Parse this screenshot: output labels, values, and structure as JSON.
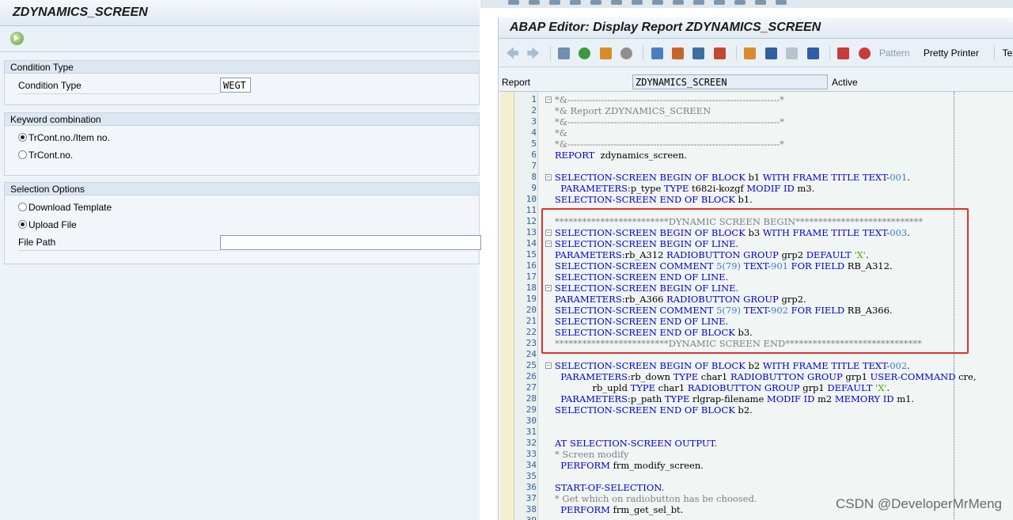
{
  "left": {
    "title": "ZDYNAMICS_SCREEN",
    "groups": {
      "condition": {
        "header": "Condition Type",
        "label": "Condition Type",
        "value": "WEGT"
      },
      "keyword": {
        "header": "Keyword combination",
        "options": [
          "TrCont.no./Item no.",
          "TrCont.no."
        ],
        "selected": 0
      },
      "selection": {
        "header": "Selection Options",
        "options": [
          "Download Template",
          "Upload File"
        ],
        "selected": 1,
        "file_label": "File Path",
        "file_value": ""
      }
    }
  },
  "right": {
    "title": "ABAP Editor: Display Report ZDYNAMICS_SCREEN",
    "toolbar": {
      "pattern": "Pattern",
      "pretty": "Pretty Printer",
      "text_elem": "Text Eler"
    },
    "report_label": "Report",
    "report_value": "ZDYNAMICS_SCREEN",
    "status": "Active"
  },
  "code_lines": [
    {
      "n": "1",
      "parts": [
        [
          "cm",
          "*&---------------------------------------------------------------------*"
        ]
      ]
    },
    {
      "n": "2",
      "parts": [
        [
          "cm",
          "*& Report ZDYNAMICS_SCREEN"
        ]
      ]
    },
    {
      "n": "3",
      "parts": [
        [
          "cm",
          "*&---------------------------------------------------------------------*"
        ]
      ]
    },
    {
      "n": "4",
      "parts": [
        [
          "cm",
          "*&"
        ]
      ]
    },
    {
      "n": "5",
      "parts": [
        [
          "cm",
          "*&---------------------------------------------------------------------*"
        ]
      ]
    },
    {
      "n": "6",
      "parts": [
        [
          "kw",
          "REPORT"
        ],
        [
          "",
          "  zdynamics_screen."
        ]
      ]
    },
    {
      "n": "7",
      "parts": []
    },
    {
      "n": "8",
      "parts": [
        [
          "kw",
          "SELECTION-SCREEN BEGIN OF BLOCK"
        ],
        [
          "",
          " b1 "
        ],
        [
          "kw",
          "WITH FRAME TITLE TEXT-"
        ],
        [
          "num",
          "001"
        ],
        [
          "",
          "."
        ]
      ]
    },
    {
      "n": "9",
      "parts": [
        [
          "kw",
          "  PARAMETERS"
        ],
        [
          "",
          ":p_type "
        ],
        [
          "kw",
          "TYPE"
        ],
        [
          "",
          " t682i-kozgf "
        ],
        [
          "kw",
          "MODIF ID"
        ],
        [
          "",
          " m3."
        ]
      ]
    },
    {
      "n": "10",
      "parts": [
        [
          "kw",
          "SELECTION-SCREEN END OF BLOCK"
        ],
        [
          "",
          " b1."
        ]
      ]
    },
    {
      "n": "11",
      "parts": []
    },
    {
      "n": "12",
      "parts": [
        [
          "cm",
          "*************************DYNAMIC SCREEN BEGIN****************************"
        ]
      ]
    },
    {
      "n": "13",
      "parts": [
        [
          "kw",
          "SELECTION-SCREEN BEGIN OF BLOCK"
        ],
        [
          "",
          " b3 "
        ],
        [
          "kw",
          "WITH FRAME TITLE TEXT-"
        ],
        [
          "num",
          "003"
        ],
        [
          "",
          "."
        ]
      ]
    },
    {
      "n": "14",
      "parts": [
        [
          "kw",
          "SELECTION-SCREEN BEGIN OF LINE."
        ]
      ]
    },
    {
      "n": "15",
      "parts": [
        [
          "kw",
          "PARAMETERS"
        ],
        [
          "",
          ":rb_A312 "
        ],
        [
          "kw",
          "RADIOBUTTON GROUP"
        ],
        [
          "",
          " grp2 "
        ],
        [
          "kw",
          "DEFAULT"
        ],
        [
          "",
          " "
        ],
        [
          "str",
          "'X'"
        ],
        [
          "",
          "."
        ]
      ]
    },
    {
      "n": "16",
      "parts": [
        [
          "kw",
          "SELECTION-SCREEN COMMENT"
        ],
        [
          "",
          " "
        ],
        [
          "num",
          "5(79)"
        ],
        [
          "",
          " "
        ],
        [
          "kw",
          "TEXT-"
        ],
        [
          "num",
          "901"
        ],
        [
          "",
          " "
        ],
        [
          "kw",
          "FOR FIELD"
        ],
        [
          "",
          " RB_A312."
        ]
      ]
    },
    {
      "n": "17",
      "parts": [
        [
          "kw",
          "SELECTION-SCREEN END OF LINE."
        ]
      ]
    },
    {
      "n": "18",
      "parts": [
        [
          "kw",
          "SELECTION-SCREEN BEGIN OF LINE."
        ]
      ]
    },
    {
      "n": "19",
      "parts": [
        [
          "kw",
          "PARAMETERS"
        ],
        [
          "",
          ":rb_A366 "
        ],
        [
          "kw",
          "RADIOBUTTON GROUP"
        ],
        [
          "",
          " grp2."
        ]
      ]
    },
    {
      "n": "20",
      "parts": [
        [
          "kw",
          "SELECTION-SCREEN COMMENT"
        ],
        [
          "",
          " "
        ],
        [
          "num",
          "5(79)"
        ],
        [
          "",
          " "
        ],
        [
          "kw",
          "TEXT-"
        ],
        [
          "num",
          "902"
        ],
        [
          "",
          " "
        ],
        [
          "kw",
          "FOR FIELD"
        ],
        [
          "",
          " RB_A366."
        ]
      ]
    },
    {
      "n": "21",
      "parts": [
        [
          "kw",
          "SELECTION-SCREEN END OF LINE."
        ]
      ]
    },
    {
      "n": "22",
      "parts": [
        [
          "kw",
          "SELECTION-SCREEN END OF BLOCK"
        ],
        [
          "",
          " b3."
        ]
      ]
    },
    {
      "n": "23",
      "parts": [
        [
          "cm",
          "*************************DYNAMIC SCREEN END******************************"
        ]
      ]
    },
    {
      "n": "24",
      "parts": []
    },
    {
      "n": "25",
      "parts": [
        [
          "kw",
          "SELECTION-SCREEN BEGIN OF BLOCK"
        ],
        [
          "",
          " b2 "
        ],
        [
          "kw",
          "WITH FRAME TITLE TEXT-"
        ],
        [
          "num",
          "002"
        ],
        [
          "",
          "."
        ]
      ]
    },
    {
      "n": "26",
      "parts": [
        [
          "kw",
          "  PARAMETERS"
        ],
        [
          "",
          ":rb_down "
        ],
        [
          "kw",
          "TYPE"
        ],
        [
          "",
          " char1 "
        ],
        [
          "kw",
          "RADIOBUTTON GROUP"
        ],
        [
          "",
          " grp1 "
        ],
        [
          "kw",
          "USER-COMMAND"
        ],
        [
          "",
          " cre,"
        ]
      ]
    },
    {
      "n": "27",
      "parts": [
        [
          "",
          "             rb_upld "
        ],
        [
          "kw",
          "TYPE"
        ],
        [
          "",
          " char1 "
        ],
        [
          "kw",
          "RADIOBUTTON GROUP"
        ],
        [
          "",
          " grp1 "
        ],
        [
          "kw",
          "DEFAULT"
        ],
        [
          "",
          " "
        ],
        [
          "str",
          "'X'"
        ],
        [
          "",
          "."
        ]
      ]
    },
    {
      "n": "28",
      "parts": [
        [
          "kw",
          "  PARAMETERS"
        ],
        [
          "",
          ":p_path "
        ],
        [
          "kw",
          "TYPE"
        ],
        [
          "",
          " rlgrap-filename "
        ],
        [
          "kw",
          "MODIF ID"
        ],
        [
          "",
          " m2 "
        ],
        [
          "kw",
          "MEMORY ID"
        ],
        [
          "",
          " m1."
        ]
      ]
    },
    {
      "n": "29",
      "parts": [
        [
          "kw",
          "SELECTION-SCREEN END OF BLOCK"
        ],
        [
          "",
          " b2."
        ]
      ]
    },
    {
      "n": "30",
      "parts": []
    },
    {
      "n": "31",
      "parts": []
    },
    {
      "n": "32",
      "parts": [
        [
          "kw",
          "AT SELECTION-SCREEN OUTPUT."
        ]
      ]
    },
    {
      "n": "33",
      "parts": [
        [
          "cm",
          "* Screen modify"
        ]
      ]
    },
    {
      "n": "34",
      "parts": [
        [
          "kw",
          "  PERFORM"
        ],
        [
          "",
          " frm_modify_screen."
        ]
      ]
    },
    {
      "n": "35",
      "parts": []
    },
    {
      "n": "36",
      "parts": [
        [
          "kw",
          "START-OF-SELECTION."
        ]
      ]
    },
    {
      "n": "37",
      "parts": [
        [
          "cm",
          "* Get which on radiobutton has be choosed."
        ]
      ]
    },
    {
      "n": "38",
      "parts": [
        [
          "kw",
          "  PERFORM"
        ],
        [
          "",
          " frm_get_sel_bt."
        ]
      ]
    },
    {
      "n": "39",
      "parts": []
    }
  ],
  "watermark": "CSDN @DeveloperMrMeng"
}
